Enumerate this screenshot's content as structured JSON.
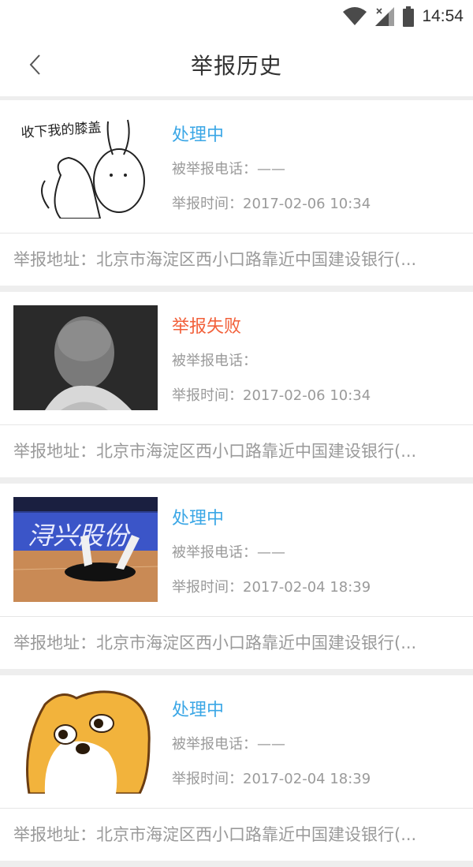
{
  "status_bar": {
    "time": "14:54"
  },
  "header": {
    "title": "举报历史"
  },
  "colors": {
    "processing": "#3ba7e6",
    "failed": "#f2603a",
    "secondary_text": "#9a9a9a"
  },
  "reports": [
    {
      "status": "处理中",
      "status_kind": "processing",
      "phone_label": "被举报电话：",
      "phone_value": "——",
      "time_label": "举报时间：",
      "time_value": "2017-02-06  10:34",
      "address_label": "举报地址：",
      "address_value": "北京市海淀区西小口路靠近中国建设银行(...",
      "image_caption": "收下我的膝盖"
    },
    {
      "status": "举报失败",
      "status_kind": "failed",
      "phone_label": "被举报电话：",
      "phone_value": "",
      "time_label": "举报时间：",
      "time_value": "2017-02-06  10:34",
      "address_label": "举报地址：",
      "address_value": "北京市海淀区西小口路靠近中国建设银行(..."
    },
    {
      "status": "处理中",
      "status_kind": "processing",
      "phone_label": "被举报电话：",
      "phone_value": "——",
      "time_label": "举报时间：",
      "time_value": "2017-02-04  18:39",
      "address_label": "举报地址：",
      "address_value": "北京市海淀区西小口路靠近中国建设银行(...",
      "image_caption": "浔兴股份"
    },
    {
      "status": "处理中",
      "status_kind": "processing",
      "phone_label": "被举报电话：",
      "phone_value": "——",
      "time_label": "举报时间：",
      "time_value": "2017-02-04  18:39",
      "address_label": "举报地址：",
      "address_value": "北京市海淀区西小口路靠近中国建设银行(..."
    }
  ]
}
